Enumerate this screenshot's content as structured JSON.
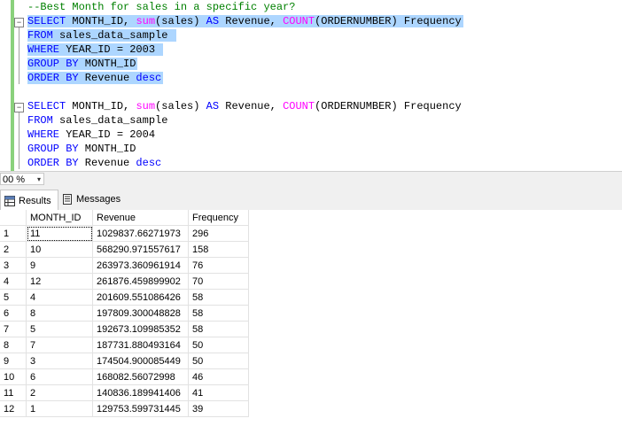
{
  "editor": {
    "lines": [
      {
        "parts": [
          {
            "t": "--Best Month for sales in a specific year?",
            "c": "cm"
          }
        ],
        "sel": false
      },
      {
        "parts": [
          {
            "t": "SELECT",
            "c": "kw"
          },
          {
            "t": " MONTH_ID, ",
            "c": ""
          },
          {
            "t": "sum",
            "c": "fn"
          },
          {
            "t": "(sales) ",
            "c": ""
          },
          {
            "t": "AS",
            "c": "kw"
          },
          {
            "t": " Revenue, ",
            "c": ""
          },
          {
            "t": "COUNT",
            "c": "fn"
          },
          {
            "t": "(ORDERNUMBER) Frequency",
            "c": ""
          }
        ],
        "sel": true
      },
      {
        "parts": [
          {
            "t": "FROM",
            "c": "kw"
          },
          {
            "t": " sales_data_sample ",
            "c": ""
          }
        ],
        "sel": true
      },
      {
        "parts": [
          {
            "t": "WHERE",
            "c": "kw"
          },
          {
            "t": " YEAR_ID = 2003 ",
            "c": ""
          }
        ],
        "sel": true
      },
      {
        "parts": [
          {
            "t": "GROUP BY",
            "c": "kw"
          },
          {
            "t": " MONTH_ID",
            "c": ""
          }
        ],
        "sel": true
      },
      {
        "parts": [
          {
            "t": "ORDER BY",
            "c": "kw"
          },
          {
            "t": " Revenue ",
            "c": ""
          },
          {
            "t": "desc",
            "c": "kw"
          }
        ],
        "sel": true
      },
      {
        "parts": [],
        "sel": false
      },
      {
        "parts": [
          {
            "t": "SELECT",
            "c": "kw"
          },
          {
            "t": " MONTH_ID, ",
            "c": ""
          },
          {
            "t": "sum",
            "c": "fn"
          },
          {
            "t": "(sales) ",
            "c": ""
          },
          {
            "t": "AS",
            "c": "kw"
          },
          {
            "t": " Revenue, ",
            "c": ""
          },
          {
            "t": "COUNT",
            "c": "fn"
          },
          {
            "t": "(ORDERNUMBER) Frequency",
            "c": ""
          }
        ],
        "sel": false
      },
      {
        "parts": [
          {
            "t": "FROM",
            "c": "kw"
          },
          {
            "t": " sales_data_sample",
            "c": ""
          }
        ],
        "sel": false
      },
      {
        "parts": [
          {
            "t": "WHERE",
            "c": "kw"
          },
          {
            "t": " YEAR_ID = 2004",
            "c": ""
          }
        ],
        "sel": false
      },
      {
        "parts": [
          {
            "t": "GROUP BY",
            "c": "kw"
          },
          {
            "t": " MONTH_ID",
            "c": ""
          }
        ],
        "sel": false
      },
      {
        "parts": [
          {
            "t": "ORDER BY",
            "c": "kw"
          },
          {
            "t": " Revenue ",
            "c": ""
          },
          {
            "t": "desc",
            "c": "kw"
          }
        ],
        "sel": false
      }
    ],
    "collapse_glyph": "−"
  },
  "zoom": {
    "value": "00 %",
    "arrow": "▾"
  },
  "tabs": {
    "results_label": "Results",
    "messages_label": "Messages"
  },
  "grid": {
    "columns": [
      "",
      "MONTH_ID",
      "Revenue",
      "Frequency"
    ],
    "rows": [
      [
        "1",
        "11",
        "1029837.66271973",
        "296"
      ],
      [
        "2",
        "10",
        "568290.971557617",
        "158"
      ],
      [
        "3",
        "9",
        "263973.360961914",
        "76"
      ],
      [
        "4",
        "12",
        "261876.459899902",
        "70"
      ],
      [
        "5",
        "4",
        "201609.551086426",
        "58"
      ],
      [
        "6",
        "8",
        "197809.300048828",
        "58"
      ],
      [
        "7",
        "5",
        "192673.109985352",
        "58"
      ],
      [
        "8",
        "7",
        "187731.880493164",
        "50"
      ],
      [
        "9",
        "3",
        "174504.900085449",
        "50"
      ],
      [
        "10",
        "6",
        "168082.56072998",
        "46"
      ],
      [
        "11",
        "2",
        "140836.189941406",
        "41"
      ],
      [
        "12",
        "1",
        "129753.599731445",
        "39"
      ]
    ]
  },
  "colors": {
    "selection": "#add6ff",
    "keyword": "#0000ff",
    "function": "#ff00ff",
    "comment": "#008000",
    "change_bar": "#8ad17c"
  }
}
